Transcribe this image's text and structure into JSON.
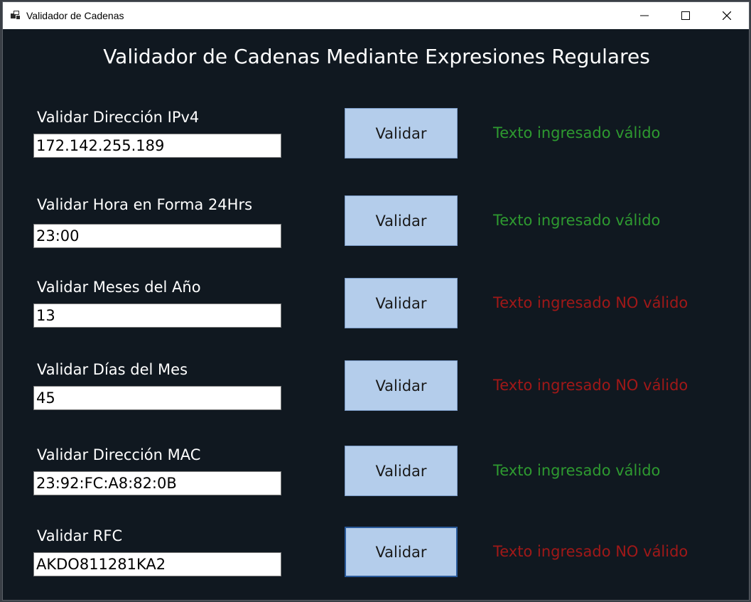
{
  "window": {
    "title": "Validador de Cadenas",
    "controls": {
      "minimize": "minimize-icon",
      "maximize": "maximize-icon",
      "close": "close-icon"
    }
  },
  "heading": "Validador de Cadenas Mediante Expresiones Regulares",
  "colors": {
    "background": "#101820",
    "button": "#b4cdeb",
    "valid": "#2e9a30",
    "invalid": "#a01818"
  },
  "rows": [
    {
      "label": "Validar Dirección IPv4",
      "value": "172.142.255.189",
      "button": "Validar",
      "result": "Texto ingresado válido",
      "status": "valid"
    },
    {
      "label": "Validar Hora en Forma 24Hrs",
      "value": "23:00",
      "button": "Validar",
      "result": "Texto ingresado válido",
      "status": "valid"
    },
    {
      "label": "Validar Meses del Año",
      "value": "13",
      "button": "Validar",
      "result": "Texto ingresado NO válido",
      "status": "invalid"
    },
    {
      "label": "Validar Días del Mes",
      "value": "45",
      "button": "Validar",
      "result": "Texto ingresado NO válido",
      "status": "invalid"
    },
    {
      "label": "Validar Dirección MAC",
      "value": "23:92:FC:A8:82:0B",
      "button": "Validar",
      "result": "Texto ingresado válido",
      "status": "valid"
    },
    {
      "label": "Validar RFC",
      "value": "AKDO811281KA2",
      "button": "Validar",
      "result": "Texto ingresado NO válido",
      "status": "invalid"
    }
  ]
}
